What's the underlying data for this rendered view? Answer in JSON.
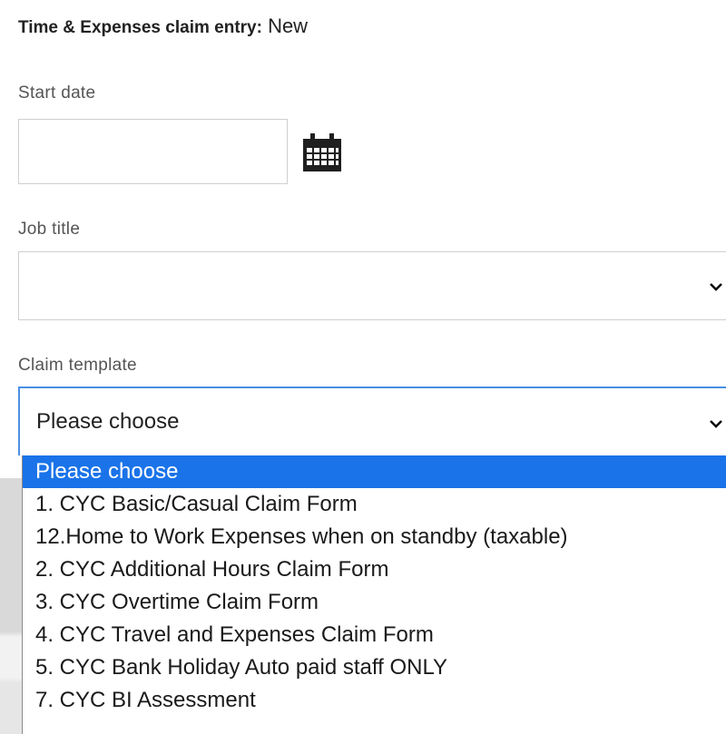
{
  "header": {
    "title_label": "Time & Expenses claim entry:",
    "title_status": "New"
  },
  "form": {
    "start_date": {
      "label": "Start date",
      "value": ""
    },
    "job_title": {
      "label": "Job title",
      "value": ""
    },
    "claim_template": {
      "label": "Claim template",
      "value": "Please choose",
      "options": [
        "Please choose",
        "1. CYC Basic/Casual Claim Form",
        "12.Home to Work Expenses when on standby (taxable)",
        "2. CYC Additional Hours Claim Form",
        "3. CYC Overtime Claim Form",
        "4. CYC Travel and Expenses Claim Form",
        "5. CYC Bank Holiday Auto paid staff ONLY",
        "7. CYC BI Assessment"
      ],
      "selected_index": 0
    }
  },
  "icons": {
    "calendar": "calendar-icon",
    "chevron": "chevron-down-icon"
  },
  "colors": {
    "accent": "#1a73e8",
    "focus_border": "#4a90e2",
    "border": "#cfcfcf"
  }
}
